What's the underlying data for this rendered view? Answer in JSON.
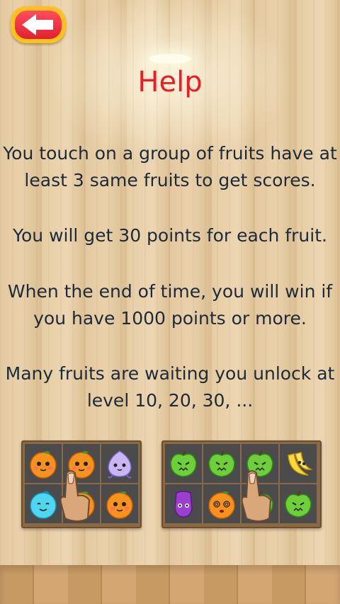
{
  "screen": {
    "title": "Help",
    "paragraphs": [
      "You touch on a group of fruits have at\nleast 3 same fruits to get scores.",
      "You will get 30 points for each fruit.",
      "When the end of time, you will win if\nyou have 1000 points or more.",
      "Many fruits are waiting you unlock at\nlevel 10, 20, 30, ..."
    ]
  },
  "back_button": {
    "icon": "back-arrow-icon",
    "color": "#ffc11a",
    "inner_color": "#e2202f"
  },
  "example_boards": [
    {
      "columns": 3,
      "cells": [
        "orange",
        "orange",
        "plum",
        "blueberry",
        "orange",
        "orange"
      ]
    },
    {
      "columns": 4,
      "cells": [
        "apple",
        "apple",
        "apple",
        "banana",
        "grape",
        "dizzy-orange",
        "apple",
        "apple"
      ]
    }
  ],
  "colors": {
    "title": "#ee1b24",
    "text": "#1c2a3a"
  }
}
